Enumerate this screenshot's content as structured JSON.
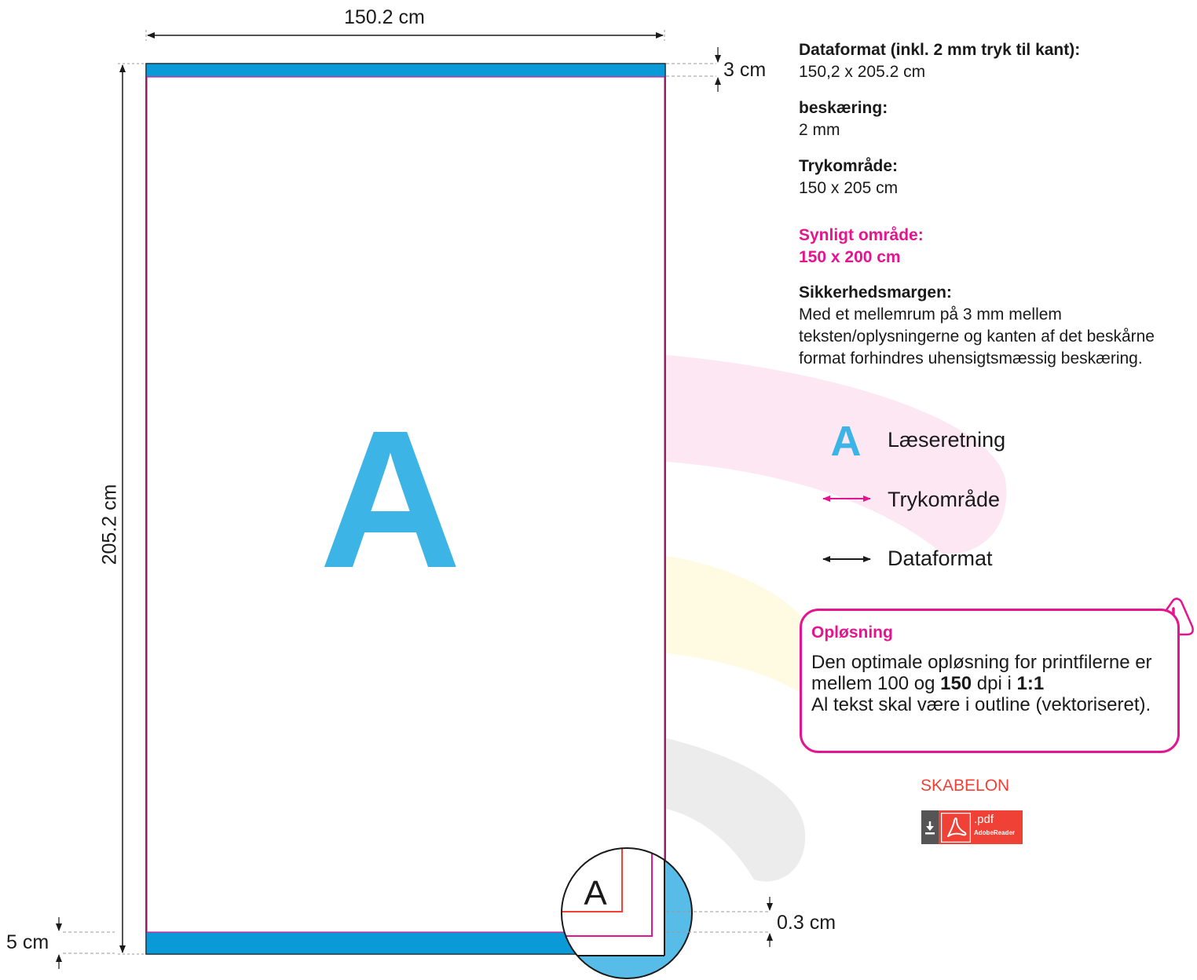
{
  "dimensions": {
    "width": "150.2 cm",
    "height": "205.2 cm",
    "top_bleed": "3 cm",
    "bottom_bleed": "5 cm",
    "inner_margin": "0.3 cm"
  },
  "sheet": {
    "letter": "A",
    "zoom_letter": "A"
  },
  "info": {
    "dataformat_title": "Dataformat (inkl. 2 mm tryk til kant):",
    "dataformat_value": "150,2 x 205.2 cm",
    "beskaering_title": "beskæring:",
    "beskaering_value": "2 mm",
    "trykomraade_title": "Trykområde:",
    "trykomraade_value": "150 x 205 cm",
    "synligt_title": "Synligt område:",
    "synligt_value": "150 x 200 cm",
    "sikkerhed_title": "Sikkerhedsmargen:",
    "sikkerhed_text": "Med et mellemrum på 3 mm mellem teksten/oplysningerne og kanten af det beskårne format forhindres uhensigtsmæssig beskæring."
  },
  "legend": {
    "a_symbol": "A",
    "a_label": "Læseretning",
    "tryk_label": "Trykområde",
    "data_label": "Dataformat"
  },
  "resolution": {
    "title": "Opløsning",
    "text_1": "Den optimale opløsning for printfilerne er mellem 100 og ",
    "text_bold_1": "150",
    "text_2": " dpi i ",
    "text_bold_2": "1:1",
    "text_3": "Al tekst skal være i outline (vektoriseret)."
  },
  "template": {
    "label": "SKABELON",
    "pdf_ext": ".pdf",
    "pdf_reader": "AdobeReader"
  },
  "colors": {
    "accent_blue": "#3cb4e5",
    "band_blue": "#0a9ad8",
    "magenta": "#e5148f",
    "red": "#ef4136"
  }
}
